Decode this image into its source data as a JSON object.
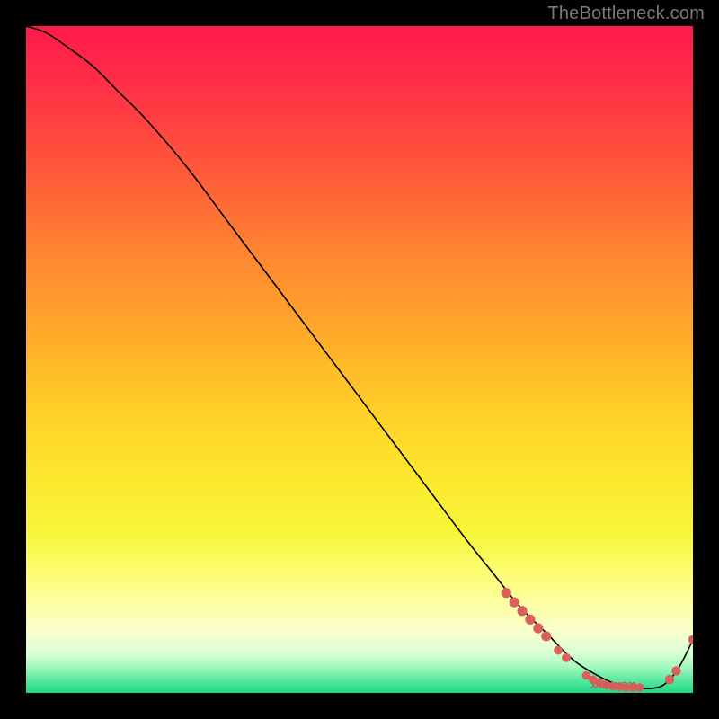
{
  "watermark": "TheBottleneck.com",
  "chart_data": {
    "type": "line",
    "title": "",
    "xlabel": "",
    "ylabel": "",
    "xlim": [
      0,
      100
    ],
    "ylim": [
      0,
      100
    ],
    "grid": false,
    "legend": false,
    "series": [
      {
        "name": "bottleneck-curve",
        "x": [
          0,
          3,
          6,
          10,
          14,
          18,
          24,
          30,
          36,
          42,
          48,
          54,
          60,
          66,
          70,
          74,
          78,
          82,
          85,
          88,
          91,
          94,
          96,
          98,
          100
        ],
        "y": [
          100,
          99,
          97,
          94,
          90,
          86,
          79,
          71,
          63,
          55,
          47,
          39,
          31,
          23,
          18,
          13,
          9,
          5,
          3,
          1.5,
          0.8,
          0.7,
          1.5,
          4,
          8
        ]
      }
    ],
    "markers": [
      {
        "name": "cluster-descent-1",
        "x": 72,
        "y": 15
      },
      {
        "name": "cluster-descent-2",
        "x": 73.2,
        "y": 13.6
      },
      {
        "name": "cluster-descent-3",
        "x": 74.4,
        "y": 12.3
      },
      {
        "name": "cluster-descent-4",
        "x": 75.6,
        "y": 11
      },
      {
        "name": "cluster-descent-5",
        "x": 76.8,
        "y": 9.7
      },
      {
        "name": "cluster-descent-6",
        "x": 78,
        "y": 8.5
      },
      {
        "name": "mid-1",
        "x": 79.8,
        "y": 6.4
      },
      {
        "name": "mid-2",
        "x": 81,
        "y": 5.3
      },
      {
        "name": "valley-1",
        "x": 84,
        "y": 2.6
      },
      {
        "name": "valley-2",
        "x": 85,
        "y": 2.0
      },
      {
        "name": "valley-3",
        "x": 86,
        "y": 1.6
      },
      {
        "name": "valley-4",
        "x": 87,
        "y": 1.2
      },
      {
        "name": "valley-5",
        "x": 88,
        "y": 1.0
      },
      {
        "name": "valley-6",
        "x": 89,
        "y": 0.9
      },
      {
        "name": "valley-7",
        "x": 90,
        "y": 0.8
      },
      {
        "name": "valley-8",
        "x": 91,
        "y": 0.8
      },
      {
        "name": "valley-9",
        "x": 92,
        "y": 0.8
      },
      {
        "name": "rise-1",
        "x": 96.5,
        "y": 2.0
      },
      {
        "name": "rise-2",
        "x": 97.5,
        "y": 3.3
      },
      {
        "name": "rise-3",
        "x": 100,
        "y": 8
      }
    ],
    "annotations": [
      {
        "name": "label-scuff",
        "text": "XNXD 01B30",
        "x": 88,
        "y": 1.1
      }
    ]
  },
  "colors": {
    "marker": "#d9605b",
    "curve": "#000000",
    "frame": "#000000"
  }
}
